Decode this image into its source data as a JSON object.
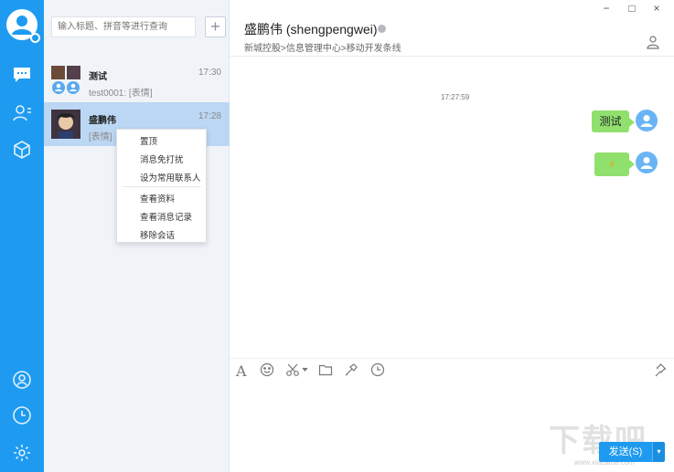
{
  "search": {
    "placeholder": "输入标题、拼音等进行查询"
  },
  "add_label": "+",
  "conversations": [
    {
      "name": "测试",
      "time": "17:30",
      "preview": "test0001: [表情]"
    },
    {
      "name": "盛鹏伟",
      "time": "17:28",
      "preview": "[表情]"
    }
  ],
  "context_menu": {
    "items": [
      "置顶",
      "消息免打扰",
      "设为常用联系人",
      "查看资料",
      "查看消息记录",
      "移除会话"
    ]
  },
  "chat": {
    "title": "盛鹏伟 (shengpengwei)",
    "breadcrumb": "新城控股>信息管理中心>移动开发条线",
    "timestamp": "17:27:59",
    "messages": [
      {
        "text": "测试"
      },
      {
        "text": "⚡"
      }
    ]
  },
  "window_controls": [
    "−",
    "□",
    "×"
  ],
  "composer": {
    "send_label": "发送(S)",
    "send_dropdown": "▾"
  },
  "watermark": {
    "main": "下载吧",
    "sub": "www.xiazaiba.com"
  },
  "colors": {
    "accent": "#1e9bf0",
    "bubble": "#90e06e",
    "selected_row": "#bcd7f4"
  },
  "icons": {
    "rail": [
      "chat-icon",
      "contacts-icon",
      "apps-cube-icon",
      "meeting-icon",
      "history-clock-icon",
      "settings-gear-icon"
    ],
    "toolbar": [
      "font-icon",
      "emoji-icon",
      "screenshot-scissors-icon",
      "folder-icon",
      "shake-icon",
      "history-clock-icon",
      "pin-icon"
    ]
  }
}
